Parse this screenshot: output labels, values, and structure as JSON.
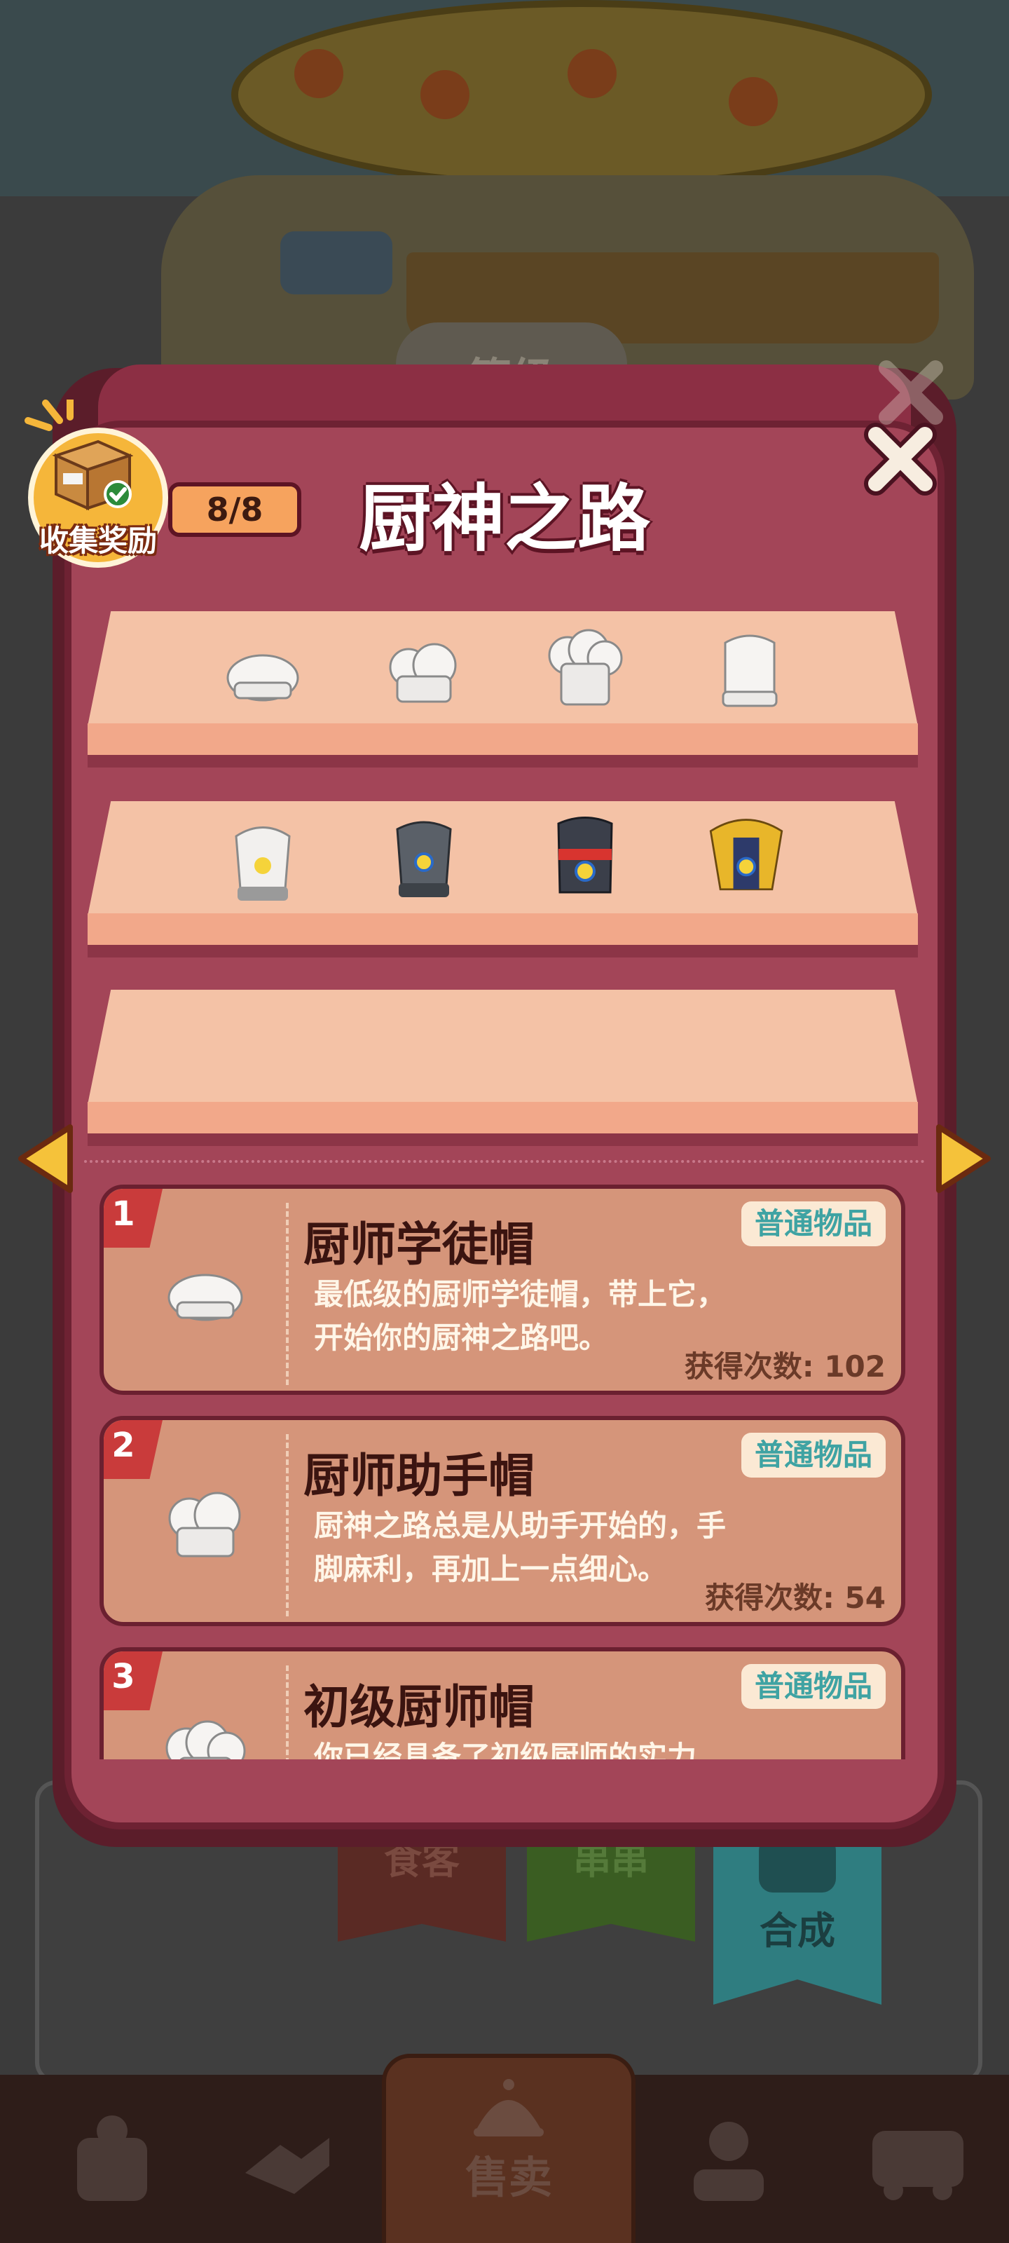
{
  "background": {
    "level_badge": "等级",
    "ribbons": [
      {
        "label": "食客",
        "color": "#5a2a24"
      },
      {
        "label": "串串",
        "color": "#3a5d22"
      },
      {
        "label": "合成",
        "color": "#2f8b8e"
      }
    ],
    "bottom_nav": {
      "sell_label": "售卖"
    }
  },
  "dialog": {
    "title": "厨神之路",
    "reward": {
      "label": "收集奖励",
      "progress": "8/8"
    },
    "shelves": [
      {
        "hats": [
          "white-hat",
          "white-hat",
          "white-hat",
          "white-hat"
        ]
      },
      {
        "hats": [
          "flower-hat-white",
          "flower-hat-gray",
          "flower-hat-dark",
          "flower-hat-gold"
        ]
      },
      {
        "hats": []
      }
    ],
    "items": [
      {
        "num": "1",
        "name": "厨师学徒帽",
        "tag": "普通物品",
        "desc_line1": "最低级的厨师学徒帽，带上它，",
        "desc_line2": "开始你的厨神之路吧。",
        "count": "获得次数: 102"
      },
      {
        "num": "2",
        "name": "厨师助手帽",
        "tag": "普通物品",
        "desc_line1": "厨神之路总是从助手开始的，手",
        "desc_line2": "脚麻利，再加上一点细心。",
        "count": "获得次数: 54"
      },
      {
        "num": "3",
        "name": "初级厨师帽",
        "tag": "普通物品",
        "desc_line1": "你已经具备了初级厨师的实力",
        "desc_line2": "",
        "count": ""
      }
    ]
  },
  "colors": {
    "dialog_bg": "#a34558",
    "dialog_border": "#6e2233",
    "shelf": "#f4c2a6",
    "card": "#d5957a",
    "tag_text": "#3fa3a3",
    "reward_circle": "#f5b63a",
    "arrow": "#f5c23a"
  }
}
